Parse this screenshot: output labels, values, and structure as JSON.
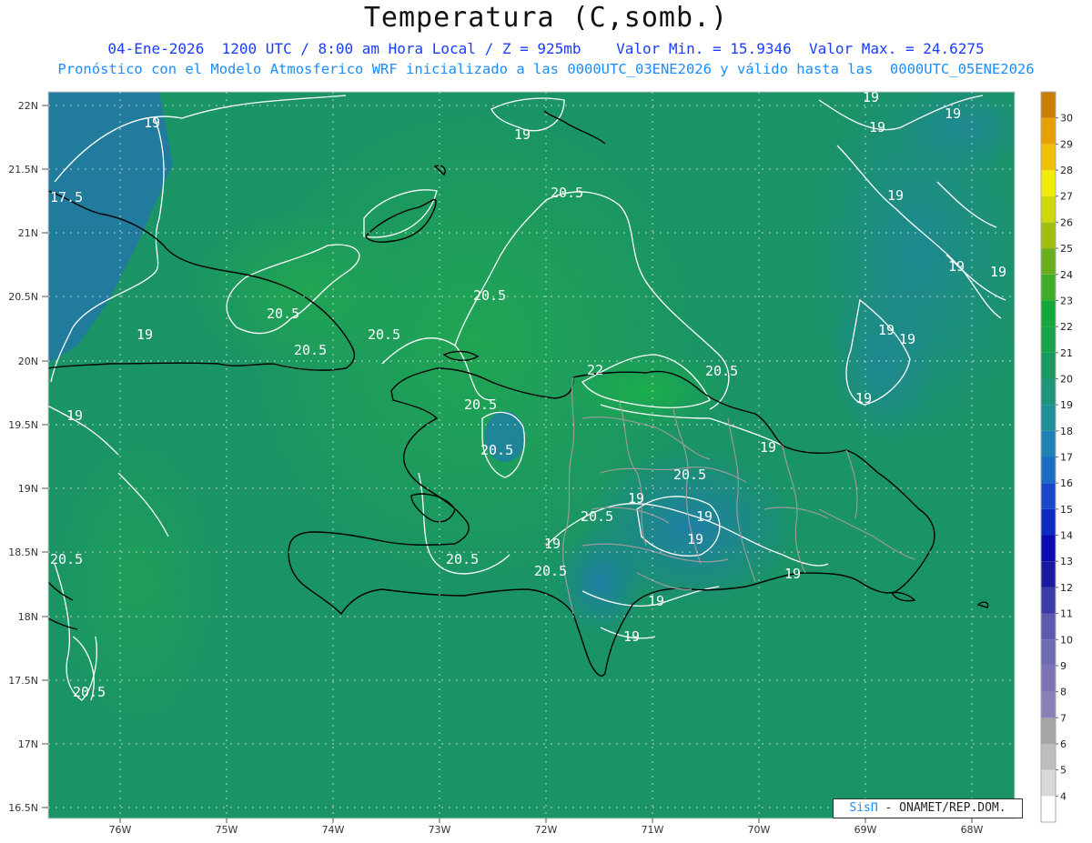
{
  "title": "Temperatura (C,somb.)",
  "subtitle_line1": "04-Ene-2026  1200 UTC / 8:00 am Hora Local / Z = 925mb    Valor Min. = 15.9346  Valor Max. = 24.6275",
  "subtitle_line2": "Pronóstico con el Modelo Atmosferico WRF inicializado a las 0000UTC_03ENE2026 y válido hasta las  0000UTC_05ENE2026",
  "credit": {
    "brand": "SisΠ",
    "text": "- ONAMET/REP.DOM."
  },
  "axes": {
    "lat_labels": [
      "22N",
      "21.5N",
      "21N",
      "20.5N",
      "20N",
      "19.5N",
      "19N",
      "18.5N",
      "18N",
      "17.5N",
      "17N",
      "16.5N"
    ],
    "lon_labels": [
      "76W",
      "75W",
      "74W",
      "73W",
      "72W",
      "71W",
      "70W",
      "69W",
      "68W"
    ]
  },
  "colorbar": {
    "ticks": [
      4,
      5,
      6,
      7,
      8,
      9,
      10,
      11,
      12,
      13,
      14,
      15,
      16,
      17,
      18,
      19,
      20,
      21,
      22,
      23,
      24,
      25,
      26,
      27,
      28,
      29,
      30
    ],
    "colors": [
      "#ffffff",
      "#d9d9d9",
      "#bdbdbd",
      "#a5a5a5",
      "#8b7fb8",
      "#7c74b4",
      "#6f6bb3",
      "#5b5bb0",
      "#3b3ba8",
      "#1a1aa0",
      "#0a0ab0",
      "#0d2bc2",
      "#1848c8",
      "#1a6cc4",
      "#1f82b4",
      "#1f8f9a",
      "#1c957c",
      "#1a9a60",
      "#17a34a",
      "#14a83c",
      "#3fae2a",
      "#6aae1e",
      "#a0bf10",
      "#cfd60a",
      "#f2ec0a",
      "#f0c008",
      "#e8a000",
      "#c87e00"
    ]
  },
  "contour_labels": [
    "19",
    "20.5",
    "22",
    "17.5"
  ]
}
